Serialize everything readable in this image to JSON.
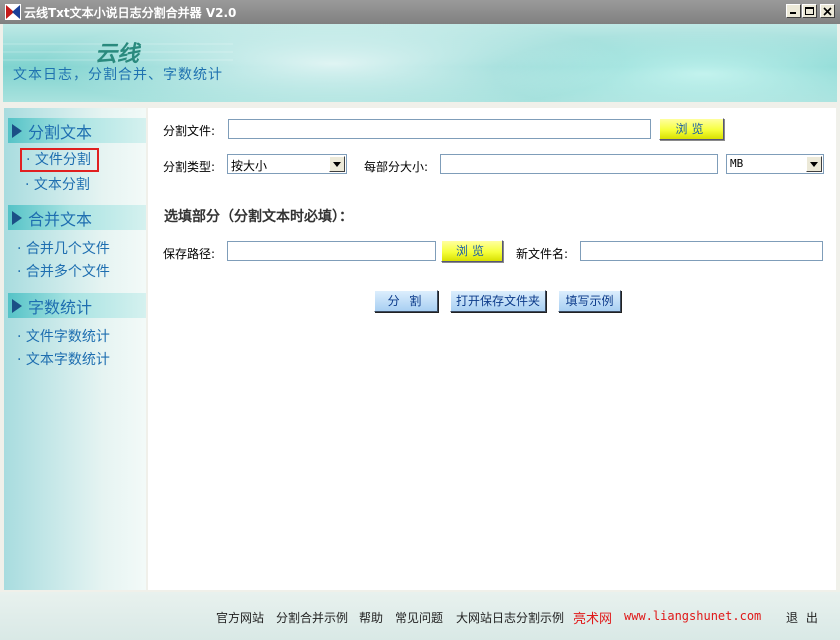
{
  "window": {
    "title": "云线Txt文本小说日志分割合并器 V2.0"
  },
  "header": {
    "logo": "云线",
    "slogan": "文本日志，分割合并、字数统计"
  },
  "sidebar": {
    "sections": [
      {
        "label": "分割文本",
        "items": [
          "· 文件分割",
          "· 文本分割"
        ]
      },
      {
        "label": "合并文本",
        "items": [
          "· 合并几个文件",
          "· 合并多个文件"
        ]
      },
      {
        "label": "字数统计",
        "items": [
          "· 文件字数统计",
          "· 文本字数统计"
        ]
      }
    ]
  },
  "form": {
    "split_file_label": "分割文件:",
    "split_file_value": "",
    "browse_label": "浏览",
    "split_type_label": "分割类型:",
    "split_type_value": "按大小",
    "part_size_label": "每部分大小:",
    "part_size_value": "",
    "unit_value": "MB",
    "optional_title": "选填部分（分割文本时必填）：",
    "save_path_label": "保存路径:",
    "save_path_value": "",
    "browse2_label": "浏览",
    "new_name_label": "新文件名:",
    "new_name_value": ""
  },
  "actions": {
    "split": "分 割",
    "open_folder": "打开保存文件夹",
    "example": "填写示例"
  },
  "footer": {
    "links": [
      "官方网站",
      "分割合并示例",
      "帮助",
      "常见问题",
      "大网站日志分割示例"
    ],
    "brand": "亮术网",
    "brand_url": "www.liangshunet.com",
    "exit": "退 出"
  },
  "colors": {
    "accent": "#1e6eb0",
    "highlight": "#e02020",
    "button_yellow": "#f6ff3c"
  }
}
